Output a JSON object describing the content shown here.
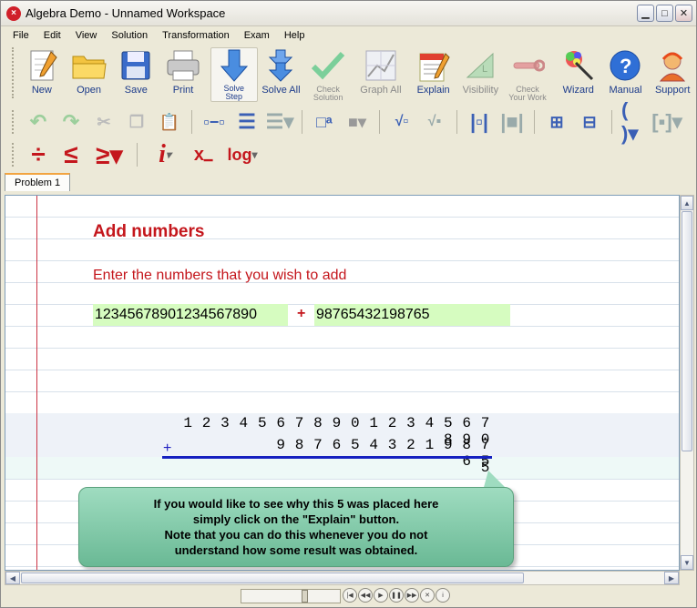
{
  "window": {
    "title": "Algebra Demo - Unnamed Workspace"
  },
  "menu": [
    "File",
    "Edit",
    "View",
    "Solution",
    "Transformation",
    "Exam",
    "Help"
  ],
  "toolbar": {
    "new": "New",
    "open": "Open",
    "save": "Save",
    "print": "Print",
    "solve_step_1": "Solve",
    "solve_step_2": "Step",
    "solve_all": "Solve All",
    "check_solution_1": "Check",
    "check_solution_2": "Solution",
    "graph_all": "Graph All",
    "explain": "Explain",
    "visibility": "Visibility",
    "check_work_1": "Check",
    "check_work_2": "Your Work",
    "wizard": "Wizard",
    "manual": "Manual",
    "support": "Support"
  },
  "toolbar3": {
    "italic_i": "i",
    "log": "log"
  },
  "tabs": [
    "Problem 1"
  ],
  "problem": {
    "heading": "Add numbers",
    "prompt": "Enter the numbers that you wish to add",
    "number1": "12345678901234567890",
    "operator": "+",
    "number2": "98765432198765"
  },
  "work": {
    "row1": "1 2 3 4 5 6 7 8 9 0 1 2 3 4 5 6 7 8 9 0",
    "row2_op": "+",
    "row2": "9 8 7 6 5 4 3 2 1 9 8 7 6 5",
    "result": "5"
  },
  "tooltip": {
    "line1": "If you would like to see why this 5 was placed here",
    "line2": "simply click on the \"Explain\" button.",
    "line3": "Note that you can do this whenever you do not",
    "line4": "understand how some result was obtained."
  }
}
